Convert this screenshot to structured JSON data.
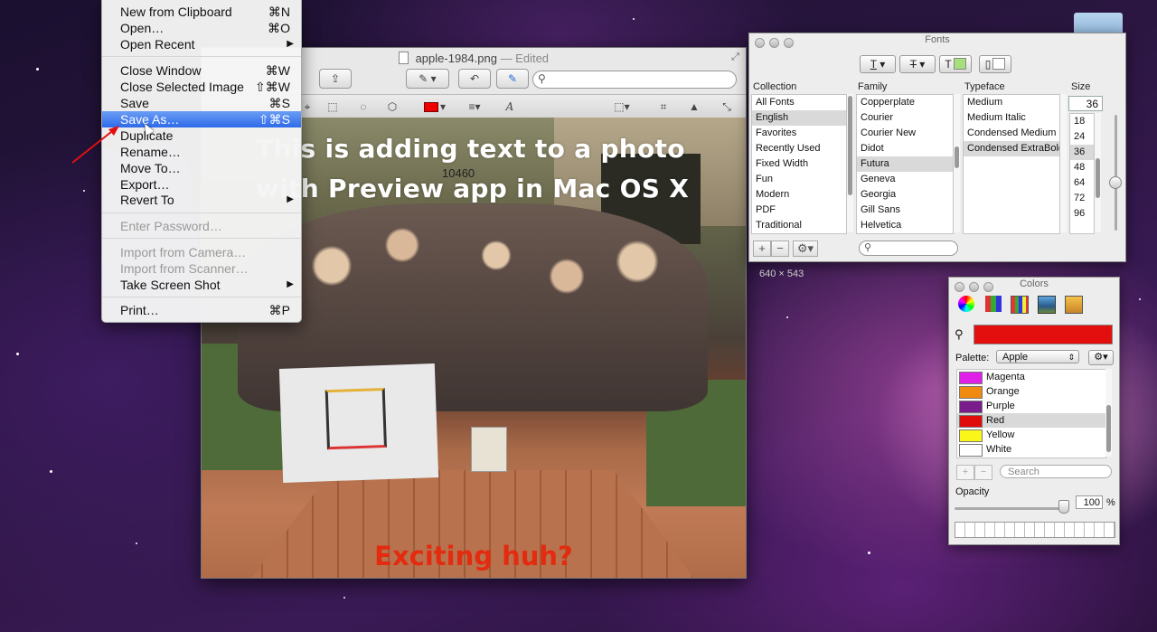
{
  "file_menu": {
    "items": [
      {
        "label": "New from Clipboard",
        "shortcut": "⌘N"
      },
      {
        "label": "Open…",
        "shortcut": "⌘O"
      },
      {
        "label": "Open Recent"
      },
      {
        "label": "Close Window",
        "shortcut": "⌘W"
      },
      {
        "label": "Close Selected Image",
        "shortcut": "⇧⌘W"
      },
      {
        "label": "Save",
        "shortcut": "⌘S"
      },
      {
        "label": "Save As…",
        "shortcut": "⇧⌘S"
      },
      {
        "label": "Duplicate"
      },
      {
        "label": "Rename…"
      },
      {
        "label": "Move To…"
      },
      {
        "label": "Export…"
      },
      {
        "label": "Revert To"
      },
      {
        "label": "Enter Password…"
      },
      {
        "label": "Import from Camera…"
      },
      {
        "label": "Import from Scanner…"
      },
      {
        "label": "Take Screen Shot"
      },
      {
        "label": "Print…",
        "shortcut": "⌘P"
      }
    ]
  },
  "preview": {
    "filename": "apple-1984.png",
    "edited": "— Edited",
    "photo_number": "10460",
    "overlay_line1": "This is adding text to a photo",
    "overlay_line2": "with Preview app in Mac OS X",
    "overlay_bottom": "Exciting huh?",
    "dimensions": "640 × 543",
    "text_color": "#e32b10"
  },
  "fonts_panel": {
    "title": "Fonts",
    "headers": {
      "collection": "Collection",
      "family": "Family",
      "typeface": "Typeface",
      "size": "Size"
    },
    "collections": [
      "All Fonts",
      "English",
      "Favorites",
      "Recently Used",
      "Fixed Width",
      "Fun",
      "Modern",
      "PDF",
      "Traditional"
    ],
    "selected_collection": "English",
    "families": [
      "Copperplate",
      "Courier",
      "Courier New",
      "Didot",
      "Futura",
      "Geneva",
      "Georgia",
      "Gill Sans",
      "Helvetica"
    ],
    "selected_family": "Futura",
    "typefaces": [
      "Medium",
      "Medium Italic",
      "Condensed Medium",
      "Condensed ExtraBold"
    ],
    "selected_typeface": "Condensed ExtraBold",
    "size_value": "36",
    "sizes": [
      "18",
      "24",
      "36",
      "48",
      "64",
      "72",
      "96"
    ],
    "selected_size": "36",
    "text_color_swatch": "#a7e07a"
  },
  "colors_panel": {
    "title": "Colors",
    "current_color": "#e30f0f",
    "palette_label": "Palette:",
    "palette_value": "Apple",
    "palette_items": [
      {
        "name": "Magenta",
        "color": "#e020e8"
      },
      {
        "name": "Orange",
        "color": "#f08a10"
      },
      {
        "name": "Purple",
        "color": "#7a1c8c"
      },
      {
        "name": "Red",
        "color": "#e00c0c"
      },
      {
        "name": "Yellow",
        "color": "#fbf61a"
      },
      {
        "name": "White",
        "color": "#ffffff"
      }
    ],
    "selected_item": "Red",
    "search_placeholder": "Search",
    "opacity_label": "Opacity",
    "opacity_value": "100",
    "opacity_unit": "%"
  }
}
